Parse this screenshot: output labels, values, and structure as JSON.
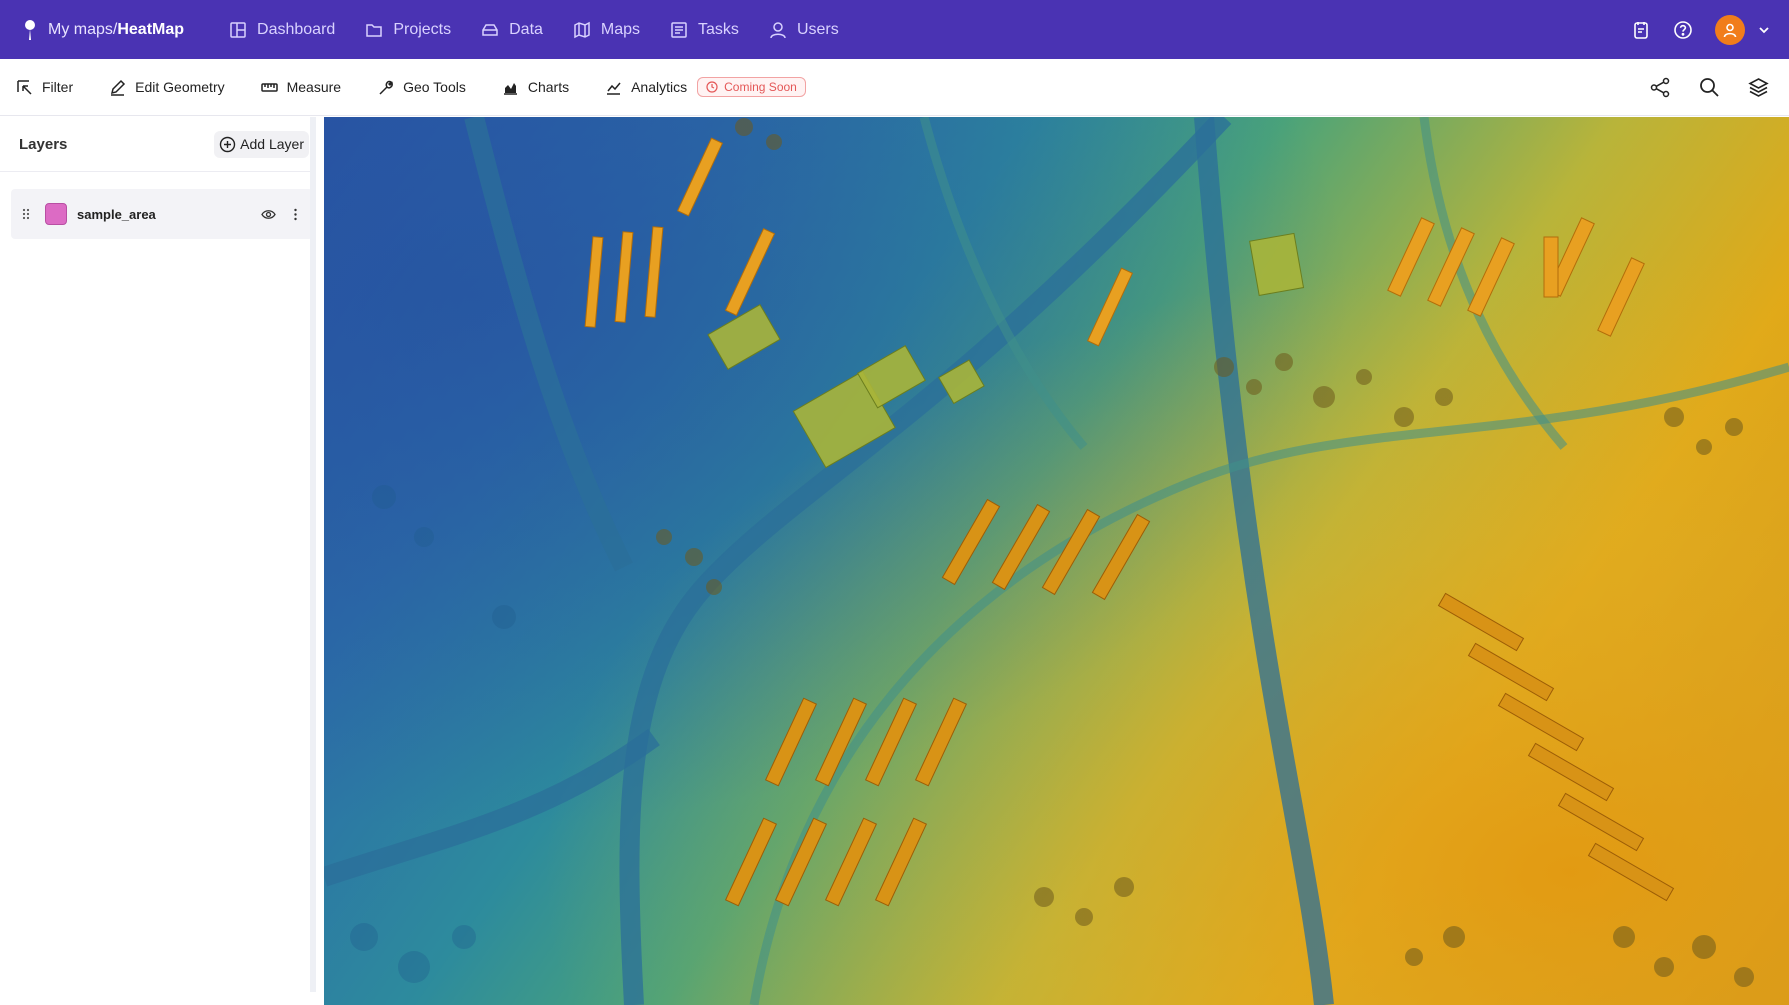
{
  "brand": {
    "crumb_parent": "My maps/",
    "crumb_current": "HeatMap"
  },
  "nav": {
    "items": [
      {
        "label": "Dashboard",
        "icon": "dashboard-icon"
      },
      {
        "label": "Projects",
        "icon": "folder-icon"
      },
      {
        "label": "Data",
        "icon": "database-icon"
      },
      {
        "label": "Maps",
        "icon": "map-icon"
      },
      {
        "label": "Tasks",
        "icon": "tasks-icon"
      },
      {
        "label": "Users",
        "icon": "user-icon"
      }
    ]
  },
  "topbar_right": {
    "icons": [
      "notes-icon",
      "help-icon",
      "avatar",
      "chevron-down-icon"
    ]
  },
  "toolbar": {
    "filter": "Filter",
    "edit_geometry": "Edit Geometry",
    "measure": "Measure",
    "geo_tools": "Geo Tools",
    "charts": "Charts",
    "analytics": "Analytics",
    "coming_soon": "Coming Soon",
    "right_icons": [
      "share-icon",
      "search-icon",
      "layers-icon"
    ]
  },
  "panel": {
    "title": "Layers",
    "add_layer": "Add Layer",
    "layers": [
      {
        "name": "sample_area",
        "color": "#dc6bc4"
      }
    ]
  },
  "colors": {
    "topbar": "#4a33b3",
    "accent_orange": "#f17d1b",
    "heatmap_low": "#2a57a6",
    "heatmap_mid": "#4aa37a",
    "heatmap_high": "#e1a918"
  }
}
